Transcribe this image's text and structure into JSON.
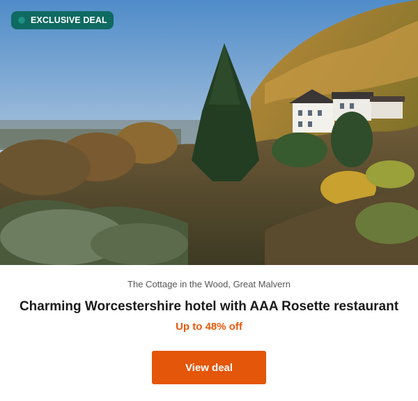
{
  "badge": {
    "label": "EXCLUSIVE DEAL"
  },
  "hero": {
    "image_label": "hotel-hillside-photo"
  },
  "deal": {
    "location": "The Cottage in the Wood, Great Malvern",
    "title": "Charming Worcestershire hotel with AAA Rosette restaurant",
    "discount": "Up to 48% off",
    "cta_label": "View deal"
  },
  "colors": {
    "badge_bg": "#0f6a62",
    "discount_text": "#e8590c",
    "cta_bg": "#e4560a"
  }
}
